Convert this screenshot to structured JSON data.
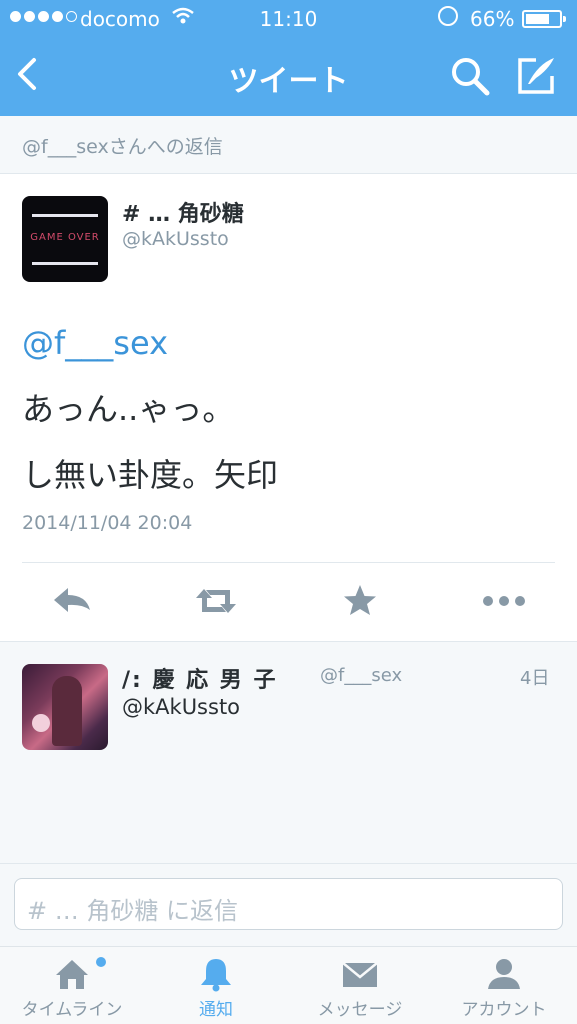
{
  "status_bar": {
    "carrier": "docomo",
    "time": "11:10",
    "battery": "66%"
  },
  "nav": {
    "title": "ツイート"
  },
  "reply_to": "@f___sexさんへの返信",
  "tweet": {
    "author_name": "# …  角砂糖",
    "author_handle": "@kAkUssto",
    "avatar_text": "GAME OVER",
    "mention": "@f___sex",
    "lines": [
      "あっん..ゃっ。",
      "し無い卦度。矢印"
    ],
    "timestamp": "2014/11/04 20:04"
  },
  "reply": {
    "name": "/:   慶 応 男 子",
    "handle": "@f___sex",
    "time": "4日",
    "text": "@kAkUssto"
  },
  "composer": {
    "placeholder": "#  …  角砂糖 に返信"
  },
  "tabs": [
    {
      "label": "タイムライン",
      "icon": "home-icon"
    },
    {
      "label": "通知",
      "icon": "bell-icon",
      "active": true
    },
    {
      "label": "メッセージ",
      "icon": "envelope-icon"
    },
    {
      "label": "アカウント",
      "icon": "person-icon"
    }
  ],
  "colors": {
    "brand": "#55acee",
    "link": "#3b94d9"
  }
}
